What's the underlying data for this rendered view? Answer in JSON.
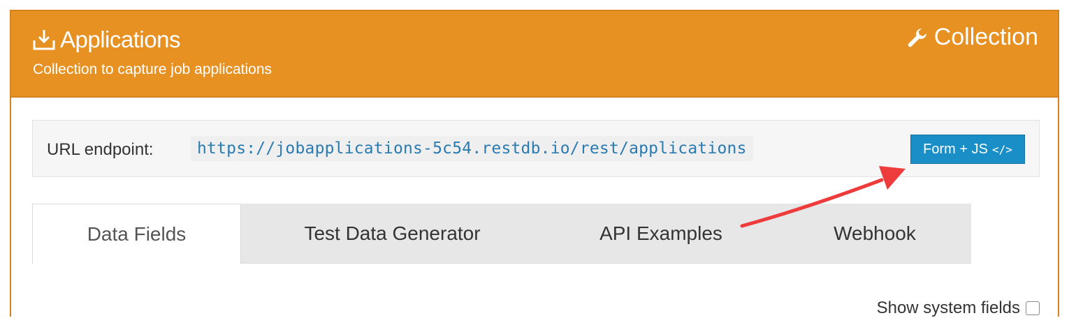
{
  "header": {
    "title": "Applications",
    "subtitle": "Collection to capture job applications",
    "collection_label": "Collection",
    "title_icon": "download-icon",
    "collection_icon": "wrench-icon"
  },
  "endpoint": {
    "label": "URL endpoint:",
    "url": "https://jobapplications-5c54.restdb.io/rest/applications",
    "button_label": "Form + JS",
    "button_icon": "</>"
  },
  "tabs": [
    {
      "label": "Data Fields",
      "active": true
    },
    {
      "label": "Test Data Generator",
      "active": false
    },
    {
      "label": "API Examples",
      "active": false
    },
    {
      "label": "Webhook",
      "active": false
    }
  ],
  "show_fields_label": "Show system fields",
  "colors": {
    "header_bg": "#e79123",
    "button_bg": "#1a8ec7",
    "url_text": "#2a7bb0",
    "annotation_arrow": "#ee3b3b"
  }
}
